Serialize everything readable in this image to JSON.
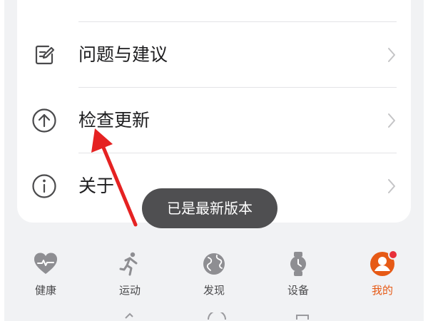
{
  "menu": {
    "items": [
      {
        "label": "问题与建议",
        "icon": "feedback-icon"
      },
      {
        "label": "检查更新",
        "icon": "arrow-up-circle-icon"
      },
      {
        "label": "关于",
        "icon": "info-icon"
      }
    ]
  },
  "toast": {
    "message": "已是最新版本"
  },
  "tabbar": {
    "tabs": [
      {
        "label": "健康",
        "icon": "heart-pulse-icon"
      },
      {
        "label": "运动",
        "icon": "running-icon"
      },
      {
        "label": "发现",
        "icon": "globe-icon"
      },
      {
        "label": "设备",
        "icon": "watch-icon"
      },
      {
        "label": "我的",
        "icon": "profile-icon",
        "active": true
      }
    ]
  },
  "colors": {
    "accent": "#e65a16",
    "badge": "#e8303a",
    "arrow": "#e52222",
    "toast_bg": "#4f4f51"
  }
}
